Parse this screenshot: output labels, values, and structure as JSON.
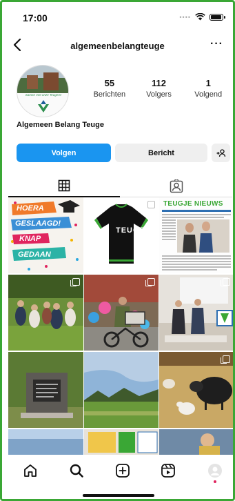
{
  "status_bar": {
    "time": "17:00"
  },
  "header": {
    "username": "algemeenbelangteuge"
  },
  "profile": {
    "display_name": "Algemeen Belang Teuge",
    "avatar_caption": "Samen met onze Teugers!",
    "stats": [
      {
        "value": "55",
        "label": "Berichten"
      },
      {
        "value": "112",
        "label": "Volgers"
      },
      {
        "value": "1",
        "label": "Volgend"
      }
    ]
  },
  "actions": {
    "follow_label": "Volgen",
    "message_label": "Bericht"
  },
  "tabs": [
    {
      "name": "posts-grid",
      "icon": "grid-icon",
      "selected": true
    },
    {
      "name": "tagged",
      "icon": "tagged-person-icon",
      "selected": false
    }
  ],
  "posts": {
    "p1": {
      "lines": [
        "HOERA",
        "GESLAAGD!",
        "KNAP",
        "GEDAAN"
      ]
    },
    "p2": {
      "text": "TEUGE"
    },
    "p3": {
      "masthead": "TEUGJE NIEUWS"
    },
    "p4": {},
    "p5": {},
    "p6": {},
    "p7": {},
    "p8": {},
    "p9": {},
    "p10": {},
    "p11": {},
    "p12": {}
  },
  "bottom_nav": [
    "home-icon",
    "search-icon",
    "create-icon",
    "reels-icon",
    "profile-icon"
  ],
  "colors": {
    "follow_button": "#1a95f0",
    "frame_border": "#3aa735",
    "notification_dot": "#e0245e"
  }
}
